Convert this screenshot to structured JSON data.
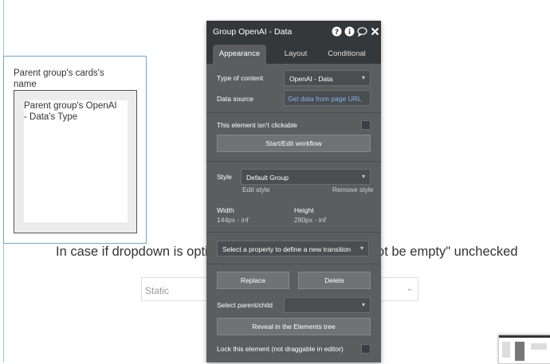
{
  "canvas": {
    "parent_group_label": "Parent group's cards's name",
    "card_text": "Parent group's OpenAI - Data's Type",
    "background_text": "In case if dropdown is optional and  \"This input should not be empty\" unchecked",
    "static_dropdown_value": "Static"
  },
  "panel": {
    "title": "Group OpenAI - Data",
    "header_icons": [
      "question-icon",
      "info-icon",
      "comment-icon",
      "close-icon"
    ],
    "tabs": [
      {
        "label": "Appearance",
        "active": true
      },
      {
        "label": "Layout",
        "active": false
      },
      {
        "label": "Conditional",
        "active": false
      }
    ],
    "type_of_content_label": "Type of content",
    "type_of_content_value": "OpenAI - Data",
    "data_source_label": "Data source",
    "data_source_value": "Get data from page URL",
    "not_clickable_label": "This element isn't clickable",
    "start_edit_workflow": "Start/Edit workflow",
    "style_label": "Style",
    "style_value": "Default Group",
    "edit_style": "Edit style",
    "remove_style": "Remove style",
    "width_label": "Width",
    "width_value": "144px - inf",
    "height_label": "Height",
    "height_value": "280px - inf",
    "transition_placeholder": "Select a property to define a new transition",
    "replace_button": "Replace",
    "delete_button": "Delete",
    "select_parent_child_label": "Select parent/child",
    "reveal_button": "Reveal in the Elements tree",
    "lock_label": "Lock this element (not draggable in editor)"
  },
  "colors": {
    "panel_bg": "#5b5d5f",
    "panel_header_bg": "#35383b",
    "link_blue": "#7fb7f0",
    "selection_border": "#6aa8e6"
  }
}
